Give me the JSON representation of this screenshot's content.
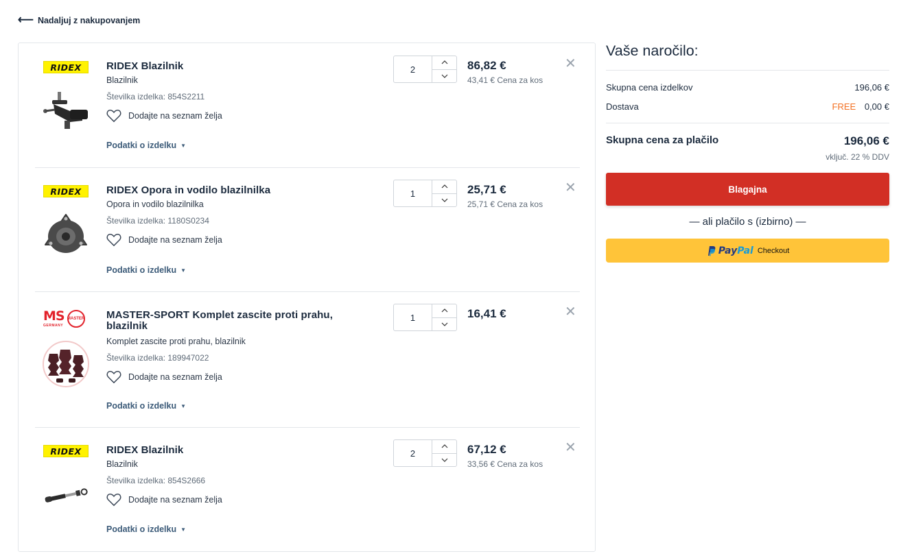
{
  "nav": {
    "back_label": "Nadaljuj z nakupovanjem"
  },
  "cart": {
    "items": [
      {
        "brand": "RIDEX",
        "title": "RIDEX Blazilnik",
        "subtitle": "Blazilnik",
        "number": "Številka izdelka: 854S2211",
        "wishlist": "Dodajte na seznam želja",
        "details": "Podatki o izdelku",
        "qty": "2",
        "price": "86,82 €",
        "unit_price": "43,41 € Cena za kos",
        "image_icon": "shock-absorber-strut-icon"
      },
      {
        "brand": "RIDEX",
        "title": "RIDEX Opora in vodilo blazilnilka",
        "subtitle": "Opora in vodilo blazilnilka",
        "number": "Številka izdelka: 1180S0234",
        "wishlist": "Dodajte na seznam želja",
        "details": "Podatki o izdelku",
        "qty": "1",
        "price": "25,71 €",
        "unit_price": "25,71 € Cena za kos",
        "image_icon": "strut-mount-icon"
      },
      {
        "brand": "MASTER-SPORT",
        "brand_short": "MS",
        "brand_sub": "GERMANY",
        "brand_seal": "MASTER",
        "title": "MASTER-SPORT Komplet zascite proti prahu, blazilnik",
        "subtitle": "Komplet zascite proti prahu, blazilnik",
        "number": "Številka izdelka: 189947022",
        "wishlist": "Dodajte na seznam želja",
        "details": "Podatki o izdelku",
        "qty": "1",
        "price": "16,41 €",
        "unit_price": "",
        "image_icon": "dust-boot-kit-icon"
      },
      {
        "brand": "RIDEX",
        "title": "RIDEX Blazilnik",
        "subtitle": "Blazilnik",
        "number": "Številka izdelka: 854S2666",
        "wishlist": "Dodajte na seznam želja",
        "details": "Podatki o izdelku",
        "qty": "2",
        "price": "67,12 €",
        "unit_price": "33,56 € Cena za kos",
        "image_icon": "shock-absorber-icon"
      }
    ]
  },
  "summary": {
    "title": "Vaše naročilo:",
    "products_label": "Skupna cena izdelkov",
    "products_value": "196,06 €",
    "shipping_label": "Dostava",
    "shipping_free": "FREE",
    "shipping_value": "0,00 €",
    "total_label": "Skupna cena za plačilo",
    "total_value": "196,06 €",
    "vat_note": "vključ. 22 % DDV",
    "checkout_label": "Blagajna",
    "alt_payment": "—  ali plačilo s (izbirno)  —",
    "paypal_pay": "Pay",
    "paypal_pal": "Pal",
    "paypal_checkout": "Checkout"
  },
  "colors": {
    "checkout": "#d22f25",
    "paypal": "#ffc439",
    "free": "#f37021",
    "ridex": "#fff200",
    "master_sport": "#e2222b"
  }
}
